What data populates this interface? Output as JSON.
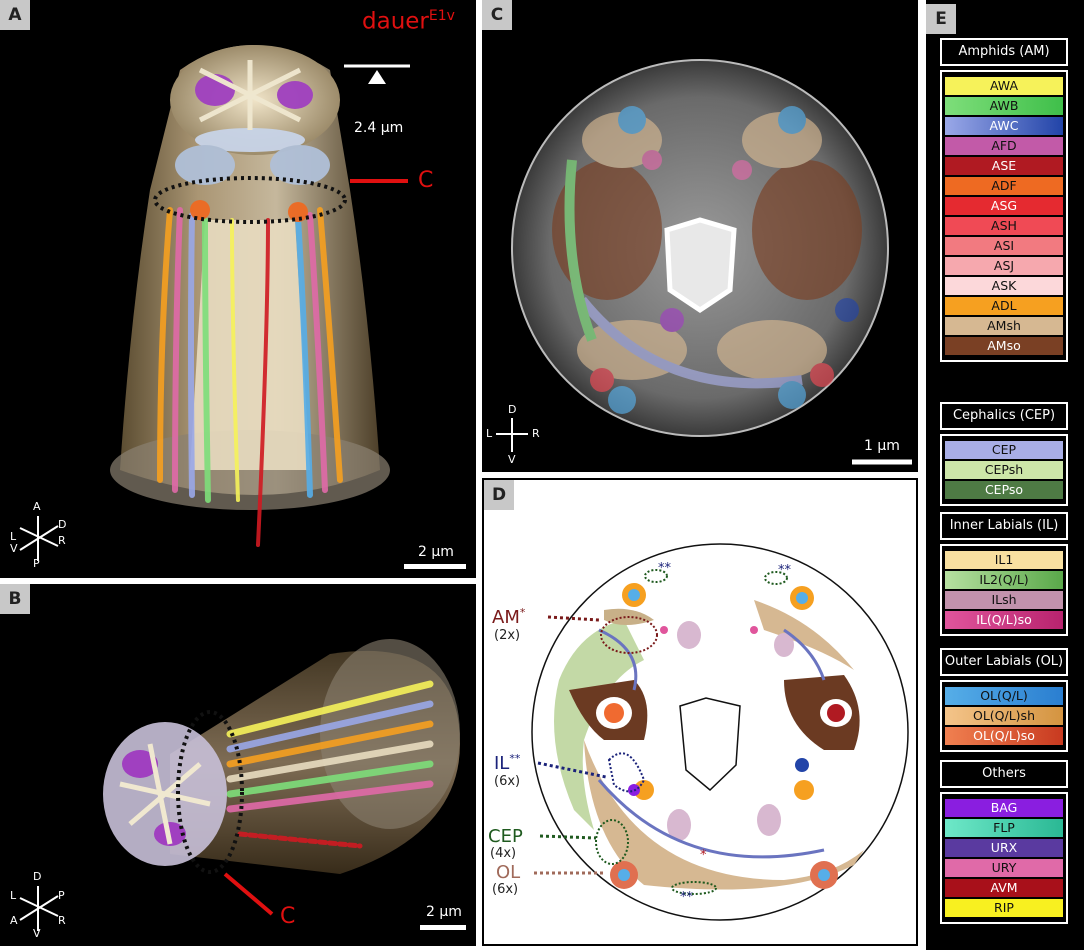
{
  "panelA": {
    "tag": "A",
    "title": "dauer",
    "title_sup": "E1v",
    "depth_label": "2.4 µm",
    "section_marker": "C",
    "scale": "2 µm",
    "axes": {
      "up": "A",
      "down": "P",
      "left_top": "L",
      "left_bottom": "V",
      "right_top": "D",
      "right_bottom": "R"
    }
  },
  "panelB": {
    "tag": "B",
    "section_marker": "C",
    "scale": "2 µm",
    "axes": {
      "up": "D",
      "down": "V",
      "left_top": "L",
      "left_bottom": "A",
      "right_top": "P",
      "right_bottom": "R"
    }
  },
  "panelC": {
    "tag": "C",
    "scale": "1 µm",
    "axes": {
      "up": "D",
      "down": "V",
      "left": "L",
      "right": "R"
    }
  },
  "panelD": {
    "tag": "D",
    "labels": [
      {
        "name": "AM",
        "sup": "*",
        "count": "(2x)",
        "color": "#7a1a1a"
      },
      {
        "name": "IL",
        "sup": "**",
        "count": "(6x)",
        "color": "#1b237a"
      },
      {
        "name": "CEP",
        "sup": "",
        "count": "(4x)",
        "color": "#1f5a1f"
      },
      {
        "name": "OL",
        "sup": "",
        "count": "(6x)",
        "color": "#a06a5a"
      }
    ],
    "marks": {
      "double_star": "**",
      "single_star": "*"
    }
  },
  "panelE": {
    "tag": "E",
    "groups": [
      {
        "title": "Amphids (AM)",
        "items": [
          {
            "label": "AWA",
            "c1": "#f6f25a",
            "c2": "#f6f25a"
          },
          {
            "label": "AWB",
            "c1": "#7ede7a",
            "c2": "#3fbf4a"
          },
          {
            "label": "AWC",
            "c1": "#9aa8e8",
            "c2": "#2244a8"
          },
          {
            "label": "AFD",
            "c1": "#c25aa8",
            "c2": "#c25aa8"
          },
          {
            "label": "ASE",
            "c1": "#b01a22",
            "c2": "#b01a22"
          },
          {
            "label": "ADF",
            "c1": "#ee6a22",
            "c2": "#ee6a22"
          },
          {
            "label": "ASG",
            "c1": "#e52a30",
            "c2": "#e52a30"
          },
          {
            "label": "ASH",
            "c1": "#f04a55",
            "c2": "#f04a55"
          },
          {
            "label": "ASI",
            "c1": "#f27a80",
            "c2": "#f27a80"
          },
          {
            "label": "ASJ",
            "c1": "#f6a8ae",
            "c2": "#f6a8ae"
          },
          {
            "label": "ASK",
            "c1": "#fcd8da",
            "c2": "#fcd8da"
          },
          {
            "label": "ADL",
            "c1": "#f6a020",
            "c2": "#f6a020"
          },
          {
            "label": "AMsh",
            "c1": "#d6b892",
            "c2": "#d6b892"
          },
          {
            "label": "AMso",
            "c1": "#7a4024",
            "c2": "#7a4024"
          }
        ]
      },
      {
        "title": "Cephalics (CEP)",
        "items": [
          {
            "label": "CEP",
            "c1": "#a8aee6",
            "c2": "#a8aee6"
          },
          {
            "label": "CEPsh",
            "c1": "#cde6a8",
            "c2": "#cde6a8"
          },
          {
            "label": "CEPso",
            "c1": "#4e7a44",
            "c2": "#4e7a44"
          }
        ]
      },
      {
        "title": "Inner Labials (IL)",
        "items": [
          {
            "label": "IL1",
            "c1": "#f8e0a0",
            "c2": "#f8e0a0"
          },
          {
            "label": "IL2(Q/L)",
            "c1": "#b6e0a0",
            "c2": "#5aa84a"
          },
          {
            "label": "ILsh",
            "c1": "#c292ac",
            "c2": "#c292ac"
          },
          {
            "label": "IL(Q/L)so",
            "c1": "#e0559c",
            "c2": "#b8236e"
          }
        ]
      },
      {
        "title": "Outer Labials (OL)",
        "items": [
          {
            "label": "OL(Q/L)",
            "c1": "#56aee8",
            "c2": "#2a7ed0"
          },
          {
            "label": "OL(Q/L)sh",
            "c1": "#f4c48a",
            "c2": "#d49440"
          },
          {
            "label": "OL(Q/L)so",
            "c1": "#f08050",
            "c2": "#c83a20"
          }
        ]
      },
      {
        "title": "Others",
        "items": [
          {
            "label": "BAG",
            "c1": "#8a1ee0",
            "c2": "#8a1ee0"
          },
          {
            "label": "FLP",
            "c1": "#6ee8c8",
            "c2": "#2ab894"
          },
          {
            "label": "URX",
            "c1": "#5a3aa0",
            "c2": "#5a3aa0"
          },
          {
            "label": "URY",
            "c1": "#e06aa8",
            "c2": "#e06aa8"
          },
          {
            "label": "AVM",
            "c1": "#a8101a",
            "c2": "#a8101a"
          },
          {
            "label": "RIP",
            "c1": "#f8f020",
            "c2": "#f8f020"
          }
        ]
      }
    ]
  }
}
